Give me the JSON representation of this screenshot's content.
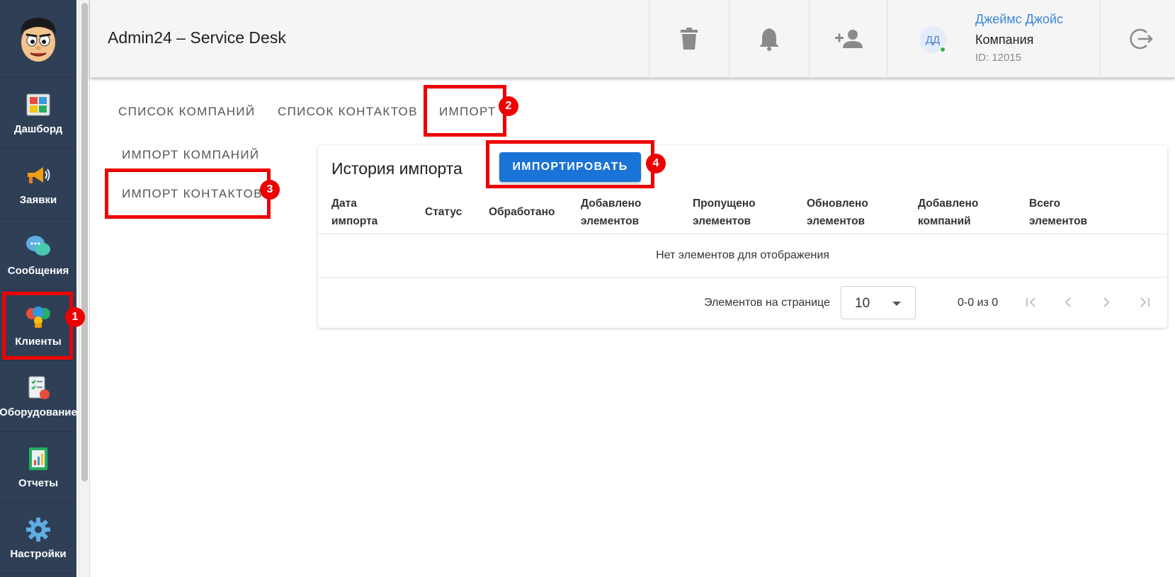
{
  "app": {
    "title": "Admin24 – Service Desk"
  },
  "sidebar": {
    "items": [
      {
        "label": "Дашборд",
        "icon": "dashboard-icon"
      },
      {
        "label": "Заявки",
        "icon": "megaphone-icon"
      },
      {
        "label": "Сообщения",
        "icon": "chat-bubbles-icon"
      },
      {
        "label": "Клиенты",
        "icon": "clients-icon"
      },
      {
        "label": "Оборудование",
        "icon": "equipment-icon"
      },
      {
        "label": "Отчеты",
        "icon": "reports-icon"
      },
      {
        "label": "Настройки",
        "icon": "settings-gear-icon"
      }
    ]
  },
  "header": {
    "actions": [
      "trash-icon",
      "bell-icon",
      "add-user-icon",
      "logout-icon"
    ],
    "user": {
      "initials": "ДД",
      "name": "Джеймс Джойс",
      "company": "Компания",
      "id": "ID: 12015"
    }
  },
  "tabs": [
    "СПИСОК КОМПАНИЙ",
    "СПИСОК КОНТАКТОВ",
    "ИМПОРТ"
  ],
  "subtabs": [
    "ИМПОРТ КОМПАНИЙ",
    "ИМПОРТ КОНТАКТОВ"
  ],
  "card": {
    "title": "История импорта",
    "import_button": "ИМПОРТИРОВАТЬ",
    "columns": [
      {
        "l1": "Дата",
        "l2": "импорта"
      },
      {
        "l1": "Статус",
        "l2": ""
      },
      {
        "l1": "Обработано",
        "l2": ""
      },
      {
        "l1": "Добавлено",
        "l2": "элементов"
      },
      {
        "l1": "Пропущено",
        "l2": "элементов"
      },
      {
        "l1": "Обновлено",
        "l2": "элементов"
      },
      {
        "l1": "Добавлено",
        "l2": "компаний"
      },
      {
        "l1": "Всего",
        "l2": "элементов"
      }
    ],
    "empty_text": "Нет элементов для отображения",
    "pagination": {
      "per_page_label": "Элементов на странице",
      "per_page_value": "10",
      "range": "0-0 из 0"
    }
  },
  "annotations": {
    "color": "#ee0000",
    "badges": [
      "1",
      "2",
      "3",
      "4"
    ]
  }
}
